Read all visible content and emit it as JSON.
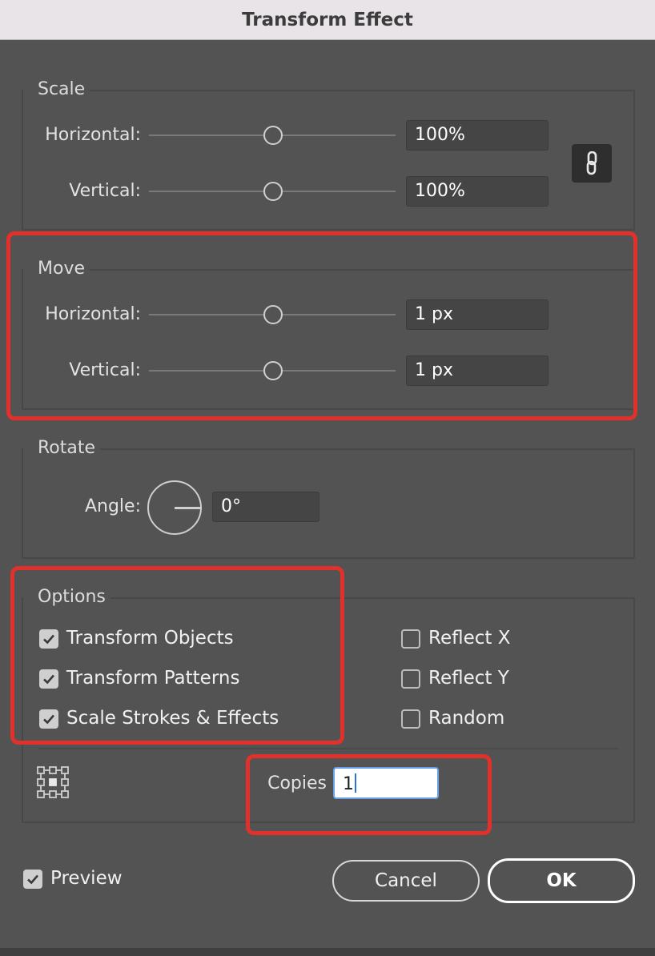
{
  "window": {
    "title": "Transform Effect"
  },
  "scale": {
    "label": "Scale",
    "horizontal": {
      "label": "Horizontal:",
      "value": "100%",
      "slider_fraction": 0.5
    },
    "vertical": {
      "label": "Vertical:",
      "value": "100%",
      "slider_fraction": 0.5
    },
    "link_icon": "link-icon"
  },
  "move": {
    "label": "Move",
    "horizontal": {
      "label": "Horizontal:",
      "value": "1 px",
      "slider_fraction": 0.5
    },
    "vertical": {
      "label": "Vertical:",
      "value": "1 px",
      "slider_fraction": 0.5
    }
  },
  "rotate": {
    "label": "Rotate",
    "angle": {
      "label": "Angle:",
      "value": "0°"
    }
  },
  "options": {
    "label": "Options",
    "transform_objects": {
      "label": "Transform Objects",
      "checked": true
    },
    "transform_patterns": {
      "label": "Transform Patterns",
      "checked": true
    },
    "scale_strokes": {
      "label": "Scale Strokes & Effects",
      "checked": true
    },
    "reflect_x": {
      "label": "Reflect X",
      "checked": false
    },
    "reflect_y": {
      "label": "Reflect Y",
      "checked": false
    },
    "random": {
      "label": "Random",
      "checked": false
    }
  },
  "copies": {
    "label": "Copies",
    "value": "1"
  },
  "preview": {
    "label": "Preview",
    "checked": true
  },
  "buttons": {
    "cancel": "Cancel",
    "ok": "OK"
  },
  "colors": {
    "highlight": "#e0312b",
    "panel": "#535353",
    "focus": "#6aa0ea"
  }
}
